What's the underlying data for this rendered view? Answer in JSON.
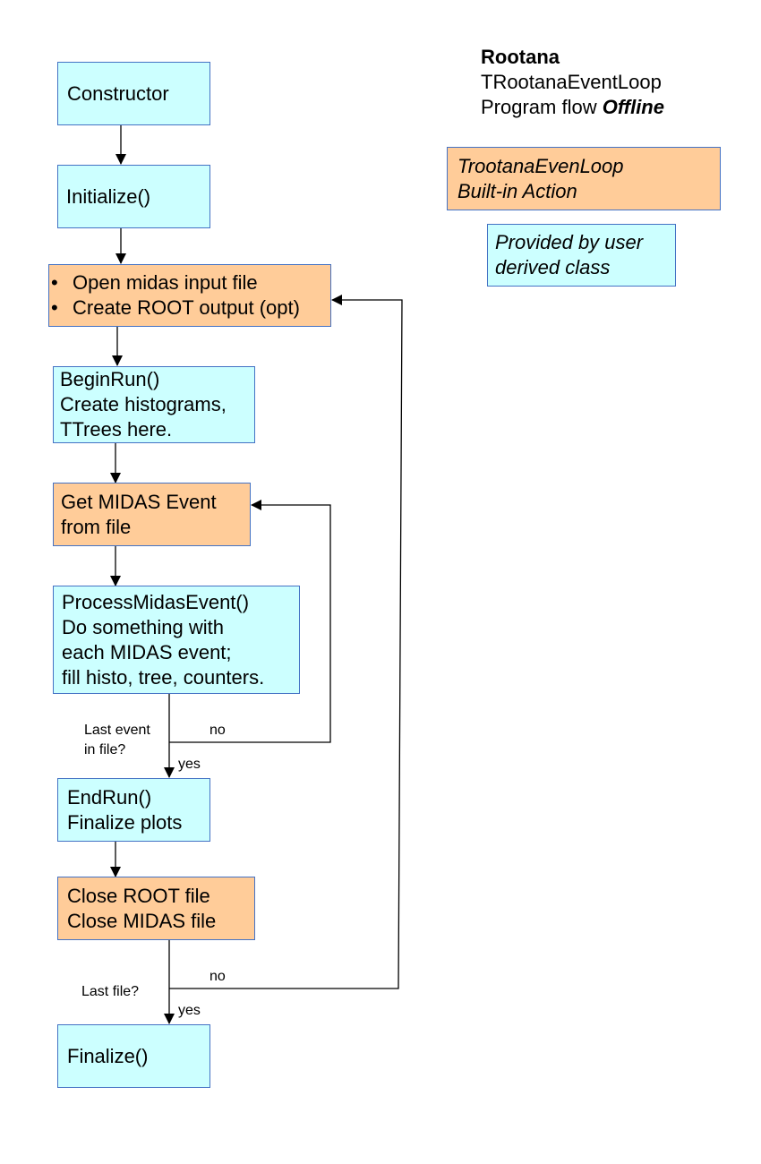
{
  "legend": {
    "title": "Rootana",
    "subtitle": "TRootanaEventLoop",
    "flow_prefix": "Program flow",
    "flow_mode": "Offline",
    "builtin_line1": "TrootanaEvenLoop",
    "builtin_line2": "Built-in Action",
    "user_line1": "Provided by user",
    "user_line2": "derived class"
  },
  "colors": {
    "user_box": "#ccffff",
    "builtin_box": "#ffcc99",
    "box_border": "#4472c4"
  },
  "nodes": {
    "constructor": {
      "lines": [
        "Constructor"
      ],
      "kind": "user"
    },
    "initialize": {
      "lines": [
        "Initialize()"
      ],
      "kind": "user"
    },
    "open_files": {
      "lines": [
        "Open midas input file",
        "Create ROOT output (opt)"
      ],
      "kind": "builtin"
    },
    "begin_run": {
      "lines": [
        "BeginRun()",
        "Create histograms,",
        "TTrees here."
      ],
      "kind": "user"
    },
    "get_event": {
      "lines": [
        "Get MIDAS Event",
        "from file"
      ],
      "kind": "builtin"
    },
    "process_event": {
      "lines": [
        "ProcessMidasEvent()",
        "Do something with",
        "each MIDAS event;",
        "fill histo, tree, counters."
      ],
      "kind": "user"
    },
    "end_run": {
      "lines": [
        "EndRun()",
        "Finalize plots"
      ],
      "kind": "user"
    },
    "close_files": {
      "lines": [
        "Close ROOT file",
        "Close MIDAS file"
      ],
      "kind": "builtin"
    },
    "finalize": {
      "lines": [
        "Finalize()"
      ],
      "kind": "user"
    }
  },
  "decisions": {
    "last_event": {
      "question_line1": "Last event",
      "question_line2": "in file?",
      "no": "no",
      "yes": "yes"
    },
    "last_file": {
      "question": "Last file?",
      "no": "no",
      "yes": "yes"
    }
  }
}
